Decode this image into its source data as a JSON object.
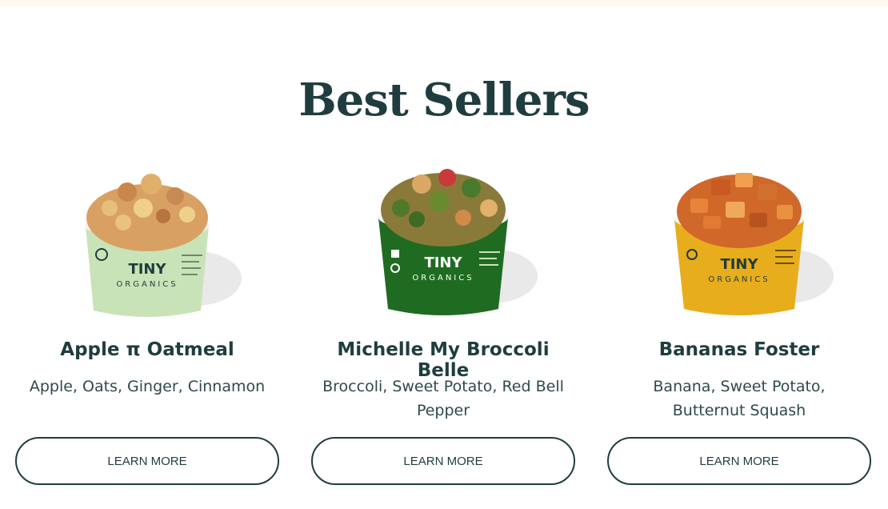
{
  "section": {
    "title": "Best Sellers"
  },
  "brand": {
    "name_line1": "TINY",
    "name_line2": "ORGANICS"
  },
  "products": [
    {
      "name": "Apple π Oatmeal",
      "ingredients": "Apple, Oats, Ginger, Cinnamon",
      "button_label": "LEARN MORE",
      "cup_color": "#c9e3b8",
      "food_color": "#d9a064"
    },
    {
      "name": "Michelle My Broccoli Belle",
      "ingredients": "Broccoli, Sweet Potato, Red Bell Pepper",
      "button_label": "LEARN MORE",
      "cup_color": "#1f6b22",
      "food_color": "#8a7a3a"
    },
    {
      "name": "Bananas Foster",
      "ingredients": "Banana, Sweet Potato, Butternut Squash",
      "button_label": "LEARN MORE",
      "cup_color": "#e8ad1c",
      "food_color": "#d0682a"
    }
  ],
  "colors": {
    "text_dark": "#1f3d3f",
    "top_bar": "#fdfbee"
  }
}
